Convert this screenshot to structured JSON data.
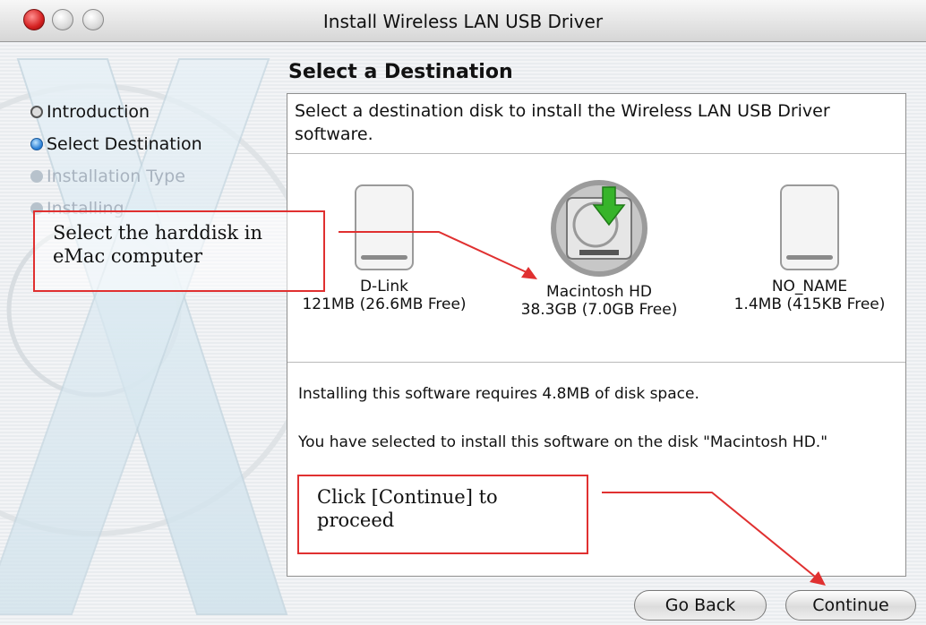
{
  "window": {
    "title": "Install Wireless LAN USB Driver"
  },
  "page": {
    "heading": "Select a Destination"
  },
  "steps": [
    {
      "label": "Introduction",
      "state": "done"
    },
    {
      "label": "Select Destination",
      "state": "current"
    },
    {
      "label": "Installation Type",
      "state": "future"
    },
    {
      "label": "Installing",
      "state": "future"
    }
  ],
  "panel": {
    "intro": "Select a destination disk to install the Wireless LAN USB Driver software.",
    "disks": [
      {
        "name": "D-Link",
        "size": "121MB (26.6MB Free)",
        "icon": "external-disk-icon"
      },
      {
        "name": "Macintosh HD",
        "size": "38.3GB (7.0GB Free)",
        "icon": "hard-disk-selected-icon"
      },
      {
        "name": "NO_NAME",
        "size": "1.4MB (415KB Free)",
        "icon": "external-disk-icon"
      }
    ],
    "space_required": "Installing this software requires 4.8MB of disk space.",
    "selection_note": "You have selected to install this software on the disk \"Macintosh HD.\""
  },
  "buttons": {
    "back": "Go Back",
    "continue": "Continue"
  },
  "annotations": {
    "harddisk": "Select the harddisk in eMac computer",
    "continue": "Click [Continue] to proceed"
  },
  "colors": {
    "annotation": "#e03030",
    "selected_step": "#2a7fd6",
    "install_arrow": "#37b42a"
  }
}
